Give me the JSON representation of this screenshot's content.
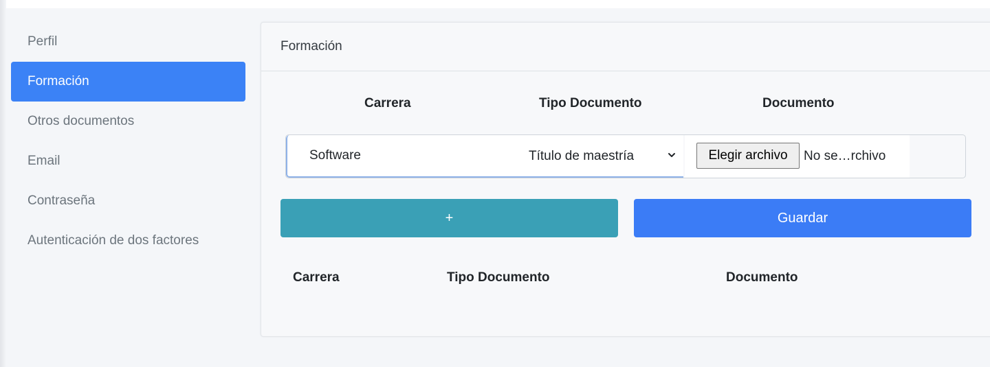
{
  "sidebar": {
    "items": [
      {
        "label": "Perfil",
        "active": false
      },
      {
        "label": "Formación",
        "active": true
      },
      {
        "label": "Otros documentos",
        "active": false
      },
      {
        "label": "Email",
        "active": false
      },
      {
        "label": "Contraseña",
        "active": false
      },
      {
        "label": "Autenticación de dos factores",
        "active": false
      }
    ]
  },
  "card": {
    "title": "Formación",
    "form_headers": {
      "carrera": "Carrera",
      "tipo_documento": "Tipo Documento",
      "documento": "Documento"
    },
    "form": {
      "carrera_value": "Software",
      "tipo_documento_value": "Título de maestría",
      "file_button_label": "Elegir archivo",
      "file_status": "No se…rchivo"
    },
    "buttons": {
      "add_label": "+",
      "save_label": "Guardar"
    },
    "table_headers": {
      "carrera": "Carrera",
      "tipo_documento": "Tipo Documento",
      "documento": "Documento"
    }
  },
  "colors": {
    "accent": "#3b82f6",
    "add_button": "#3aa0b6",
    "save_button": "#3b7cf6"
  }
}
